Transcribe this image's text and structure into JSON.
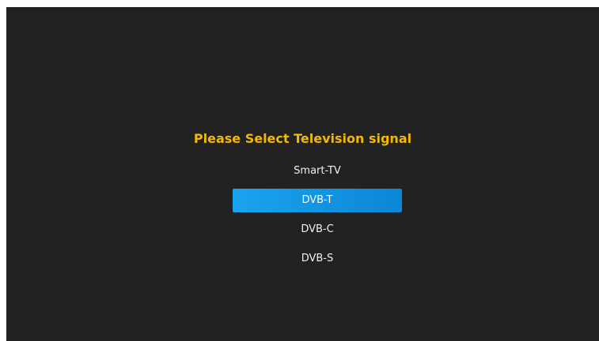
{
  "screen": {
    "title": "Please Select Television signal",
    "title_color": "#f5b800",
    "background_color": "#222222",
    "highlight_color": "#1a9be8",
    "options": [
      {
        "label": "Smart-TV",
        "selected": false
      },
      {
        "label": "DVB-T",
        "selected": true
      },
      {
        "label": "DVB-C",
        "selected": false
      },
      {
        "label": "DVB-S",
        "selected": false
      }
    ]
  }
}
